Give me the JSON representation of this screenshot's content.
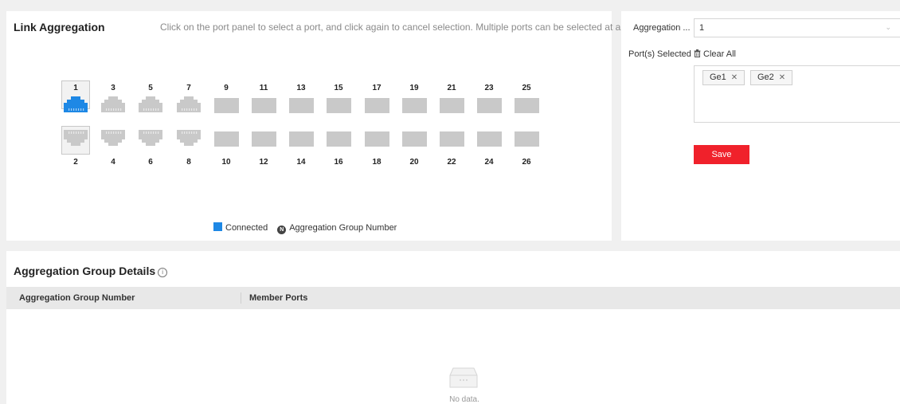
{
  "link_aggregation": {
    "title": "Link Aggregation",
    "hint": "Click on the port panel to select a port, and click again to cancel selection. Multiple ports can be selected at a time.",
    "ports_top": [
      {
        "label": "1",
        "type": "rj45",
        "state": "connected",
        "selected": true
      },
      {
        "label": "3",
        "type": "rj45",
        "state": "disconnected",
        "selected": false
      },
      {
        "label": "5",
        "type": "rj45",
        "state": "disconnected",
        "selected": false
      },
      {
        "label": "7",
        "type": "rj45",
        "state": "disconnected",
        "selected": false
      },
      {
        "label": "9",
        "type": "sfp",
        "state": "disconnected",
        "selected": false
      },
      {
        "label": "11",
        "type": "sfp",
        "state": "disconnected",
        "selected": false
      },
      {
        "label": "13",
        "type": "sfp",
        "state": "disconnected",
        "selected": false
      },
      {
        "label": "15",
        "type": "sfp",
        "state": "disconnected",
        "selected": false
      },
      {
        "label": "17",
        "type": "sfp",
        "state": "disconnected",
        "selected": false
      },
      {
        "label": "19",
        "type": "sfp",
        "state": "disconnected",
        "selected": false
      },
      {
        "label": "21",
        "type": "sfp",
        "state": "disconnected",
        "selected": false
      },
      {
        "label": "23",
        "type": "sfp",
        "state": "disconnected",
        "selected": false
      },
      {
        "label": "25",
        "type": "sfp",
        "state": "disconnected",
        "selected": false
      }
    ],
    "ports_bottom": [
      {
        "label": "2",
        "type": "rj45",
        "state": "disconnected",
        "selected": true
      },
      {
        "label": "4",
        "type": "rj45",
        "state": "disconnected",
        "selected": false
      },
      {
        "label": "6",
        "type": "rj45",
        "state": "disconnected",
        "selected": false
      },
      {
        "label": "8",
        "type": "rj45",
        "state": "disconnected",
        "selected": false
      },
      {
        "label": "10",
        "type": "sfp",
        "state": "disconnected",
        "selected": false
      },
      {
        "label": "12",
        "type": "sfp",
        "state": "disconnected",
        "selected": false
      },
      {
        "label": "14",
        "type": "sfp",
        "state": "disconnected",
        "selected": false
      },
      {
        "label": "16",
        "type": "sfp",
        "state": "disconnected",
        "selected": false
      },
      {
        "label": "18",
        "type": "sfp",
        "state": "disconnected",
        "selected": false
      },
      {
        "label": "20",
        "type": "sfp",
        "state": "disconnected",
        "selected": false
      },
      {
        "label": "22",
        "type": "sfp",
        "state": "disconnected",
        "selected": false
      },
      {
        "label": "24",
        "type": "sfp",
        "state": "disconnected",
        "selected": false
      },
      {
        "label": "26",
        "type": "sfp",
        "state": "disconnected",
        "selected": false
      }
    ],
    "legend": {
      "connected": "Connected",
      "group_number_marker": "N",
      "group_number": "Aggregation Group Number"
    },
    "colors": {
      "connected": "#1e88e5",
      "disconnected": "#c9c9c9",
      "accent": "#f0212b"
    }
  },
  "settings": {
    "aggregation_label": "Aggregation ...",
    "aggregation_value": "1",
    "ports_selected_label": "Port(s) Selected",
    "clear_all": "Clear All",
    "selected_tags": [
      "Ge1",
      "Ge2"
    ],
    "save": "Save"
  },
  "details": {
    "title": "Aggregation Group Details",
    "columns": [
      "Aggregation Group Number",
      "Member Ports"
    ],
    "rows": [],
    "empty_text": "No data."
  },
  "icons": {
    "trash": "trash-icon",
    "info": "info-icon",
    "chevron": "chevron-down-icon",
    "empty": "empty-box-icon",
    "tag_remove": "close-icon"
  }
}
